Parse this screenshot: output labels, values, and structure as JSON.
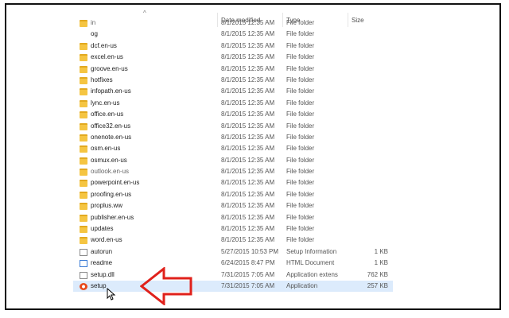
{
  "columns": {
    "name": "",
    "date": "Date modified",
    "type": "Type",
    "size": "Size"
  },
  "rows": [
    {
      "name": "in",
      "date": "8/1/2015 12:35 AM",
      "type": "File folder",
      "size": "",
      "icon": "folder-icon",
      "partial": true
    },
    {
      "name": "og",
      "date": "8/1/2015 12:35 AM",
      "type": "File folder",
      "size": "",
      "icon": "none"
    },
    {
      "name": "dcf.en-us",
      "date": "8/1/2015 12:35 AM",
      "type": "File folder",
      "size": "",
      "icon": "folder-icon"
    },
    {
      "name": "excel.en-us",
      "date": "8/1/2015 12:35 AM",
      "type": "File folder",
      "size": "",
      "icon": "folder-icon"
    },
    {
      "name": "groove.en-us",
      "date": "8/1/2015 12:35 AM",
      "type": "File folder",
      "size": "",
      "icon": "folder-icon"
    },
    {
      "name": "hotfixes",
      "date": "8/1/2015 12:35 AM",
      "type": "File folder",
      "size": "",
      "icon": "folder-icon"
    },
    {
      "name": "infopath.en-us",
      "date": "8/1/2015 12:35 AM",
      "type": "File folder",
      "size": "",
      "icon": "folder-icon"
    },
    {
      "name": "lync.en-us",
      "date": "8/1/2015 12:35 AM",
      "type": "File folder",
      "size": "",
      "icon": "folder-icon"
    },
    {
      "name": "office.en-us",
      "date": "8/1/2015 12:35 AM",
      "type": "File folder",
      "size": "",
      "icon": "folder-icon"
    },
    {
      "name": "office32.en-us",
      "date": "8/1/2015 12:35 AM",
      "type": "File folder",
      "size": "",
      "icon": "folder-icon"
    },
    {
      "name": "onenote.en-us",
      "date": "8/1/2015 12:35 AM",
      "type": "File folder",
      "size": "",
      "icon": "folder-icon"
    },
    {
      "name": "osm.en-us",
      "date": "8/1/2015 12:35 AM",
      "type": "File folder",
      "size": "",
      "icon": "folder-icon"
    },
    {
      "name": "osmux.en-us",
      "date": "8/1/2015 12:35 AM",
      "type": "File folder",
      "size": "",
      "icon": "folder-icon"
    },
    {
      "name": "outlook.en-us",
      "date": "8/1/2015 12:35 AM",
      "type": "File folder",
      "size": "",
      "icon": "folder-icon",
      "partial": true
    },
    {
      "name": "powerpoint.en-us",
      "date": "8/1/2015 12:35 AM",
      "type": "File folder",
      "size": "",
      "icon": "folder-icon"
    },
    {
      "name": "proofing.en-us",
      "date": "8/1/2015 12:35 AM",
      "type": "File folder",
      "size": "",
      "icon": "folder-icon"
    },
    {
      "name": "proplus.ww",
      "date": "8/1/2015 12:35 AM",
      "type": "File folder",
      "size": "",
      "icon": "folder-icon"
    },
    {
      "name": "publisher.en-us",
      "date": "8/1/2015 12:35 AM",
      "type": "File folder",
      "size": "",
      "icon": "folder-icon"
    },
    {
      "name": "updates",
      "date": "8/1/2015 12:35 AM",
      "type": "File folder",
      "size": "",
      "icon": "folder-icon"
    },
    {
      "name": "word.en-us",
      "date": "8/1/2015 12:35 AM",
      "type": "File folder",
      "size": "",
      "icon": "folder-icon"
    },
    {
      "name": "autorun",
      "date": "5/27/2015 10:53 PM",
      "type": "Setup Information",
      "size": "1 KB",
      "icon": "settings-file-icon"
    },
    {
      "name": "readme",
      "date": "6/24/2015 8:47 PM",
      "type": "HTML Document",
      "size": "1 KB",
      "icon": "html-file-icon"
    },
    {
      "name": "setup.dll",
      "date": "7/31/2015 7:05 AM",
      "type": "Application extens",
      "size": "762 KB",
      "icon": "dll-file-icon"
    },
    {
      "name": "setup",
      "date": "7/31/2015 7:05 AM",
      "type": "Application",
      "size": "257 KB",
      "icon": "office-app-icon",
      "selected": true
    }
  ],
  "colors": {
    "annotation_arrow": "#e0211b",
    "folder": "#f5c542",
    "selection": "#dcebfc"
  }
}
